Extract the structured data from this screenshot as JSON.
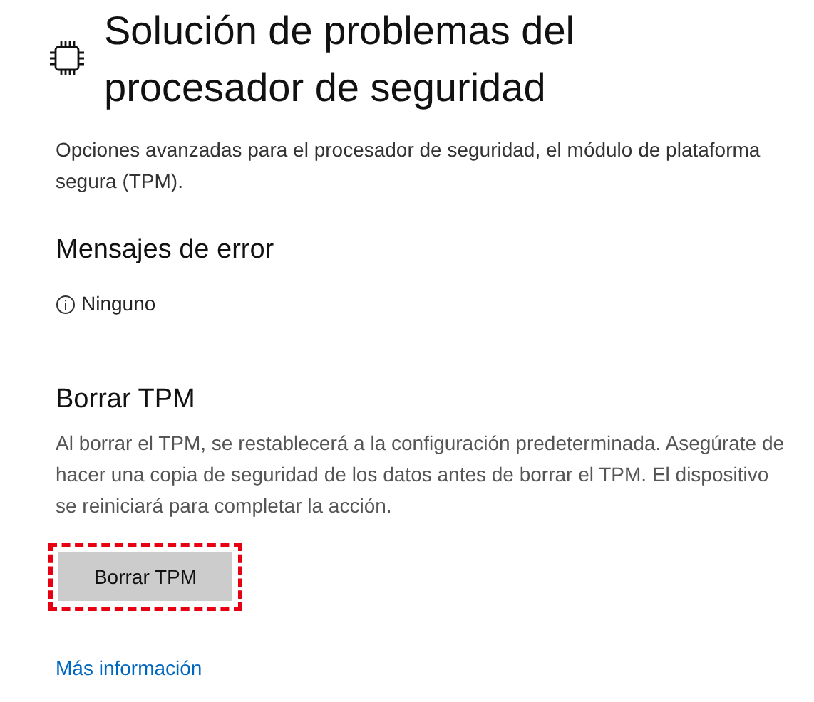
{
  "header": {
    "title": "Solución de problemas del procesador de seguridad"
  },
  "description": "Opciones avanzadas para el procesador de seguridad, el módulo de plataforma segura (TPM).",
  "error_section": {
    "heading": "Mensajes de error",
    "status": "Ninguno"
  },
  "clear_section": {
    "heading": "Borrar TPM",
    "text": "Al borrar el TPM, se restablecerá a la configuración predeterminada. Asegúrate de hacer una copia de seguridad de los datos antes de borrar el TPM. El dispositivo se reiniciará para completar la acción.",
    "button": {
      "label": "Borrar TPM",
      "highlighted": true
    }
  },
  "link": "Más información"
}
